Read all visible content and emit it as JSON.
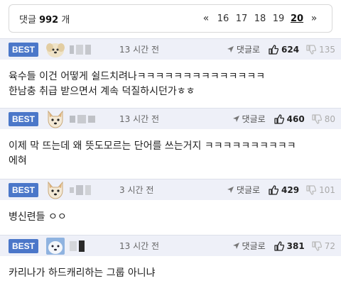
{
  "header": {
    "count_label": "댓글",
    "count_value": "992",
    "count_unit": "개",
    "prev_icon": "«",
    "next_icon": "»",
    "pages": [
      "16",
      "17",
      "18",
      "19",
      "20"
    ],
    "current_page": "20"
  },
  "comments": [
    {
      "badge": "BEST",
      "time": "13 시간 전",
      "reply_label": "댓글로",
      "likes": "624",
      "dislikes": "135",
      "lines": [
        "육수들 이건 어떻게 쉴드치려나ㅋㅋㅋㅋㅋㅋㅋㅋㅋㅋㅋㅋㅋㅋ",
        "한남충 취급 받으면서 계속 덕질하시던가ㅎㅎ"
      ]
    },
    {
      "badge": "BEST",
      "time": "13 시간 전",
      "reply_label": "댓글로",
      "likes": "460",
      "dislikes": "80",
      "lines": [
        "이제 막 뜨는데 왜 뜻도모르는 단어를 쓰는거지 ㅋㅋㅋㅋㅋㅋㅋㅋㅋㅋ",
        "에혀"
      ]
    },
    {
      "badge": "BEST",
      "time": "3 시간 전",
      "reply_label": "댓글로",
      "likes": "429",
      "dislikes": "101",
      "lines": [
        "병신련들 ㅇㅇ"
      ]
    },
    {
      "badge": "BEST",
      "time": "13 시간 전",
      "reply_label": "댓글로",
      "likes": "381",
      "dislikes": "72",
      "lines": [
        "카리나가 하드캐리하는 그룹 아니냐"
      ]
    }
  ],
  "colors": {
    "best_badge": "#4b77c9",
    "header_bg": "#eef0f8"
  },
  "icons": {
    "reply": "send-arrow-icon",
    "like": "thumbs-up-icon",
    "dislike": "thumbs-down-icon"
  }
}
